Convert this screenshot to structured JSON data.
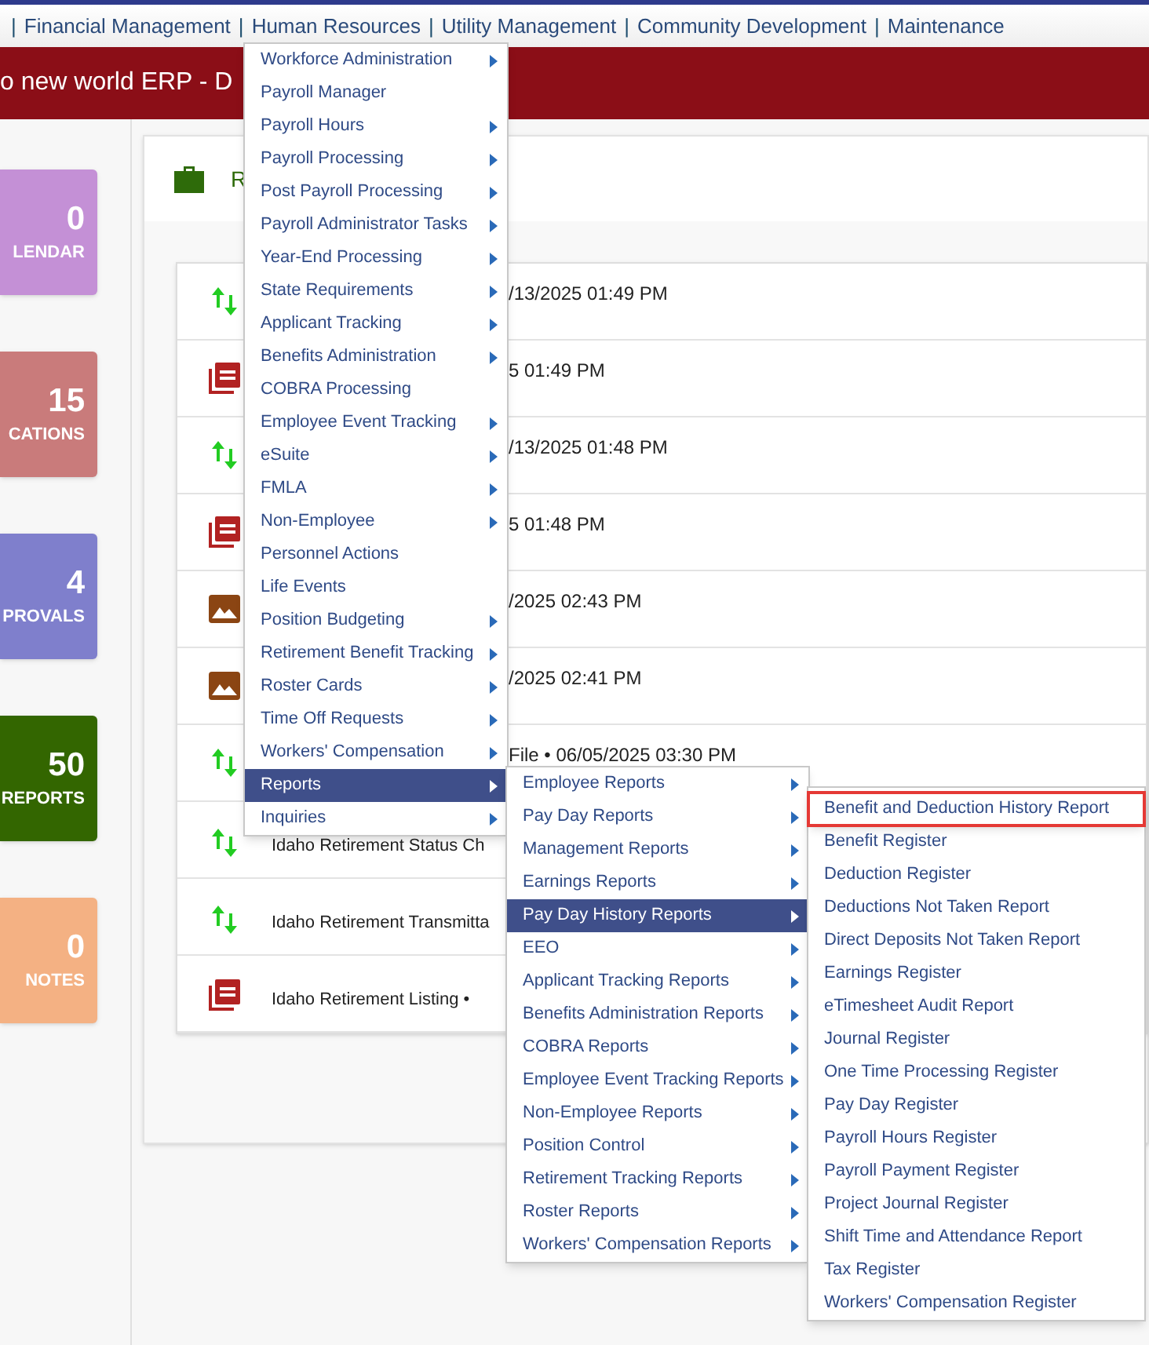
{
  "nav": {
    "items": [
      {
        "kind": "separator",
        "text": "|"
      },
      {
        "kind": "link",
        "text": "Financial Management"
      },
      {
        "kind": "separator",
        "text": "|"
      },
      {
        "kind": "link",
        "text": "Human Resources"
      },
      {
        "kind": "separator",
        "text": "|"
      },
      {
        "kind": "link",
        "text": "Utility Management"
      },
      {
        "kind": "separator",
        "text": "|"
      },
      {
        "kind": "link",
        "text": "Community Development"
      },
      {
        "kind": "separator",
        "text": "|"
      },
      {
        "kind": "link",
        "text": "Maintenance"
      }
    ]
  },
  "banner": {
    "title": "o new world ERP - D"
  },
  "tiles": [
    {
      "count": "0",
      "label": "LENDAR",
      "color": "#c490d6"
    },
    {
      "count": "15",
      "label": "CATIONS",
      "color": "#c97b7b"
    },
    {
      "count": "4",
      "label": "PROVALS",
      "color": "#7f7fcc"
    },
    {
      "count": "50",
      "label": "REPORTS",
      "color": "#336600"
    },
    {
      "count": "0",
      "label": "NOTES",
      "color": "#f4b183"
    }
  ],
  "panel": {
    "title": "R"
  },
  "rows": [
    {
      "kind": "transfer",
      "text": "/13/2025 01:49 PM",
      "start_hidden": true
    },
    {
      "kind": "pdf",
      "text": "5 01:49 PM",
      "start_hidden": true
    },
    {
      "kind": "transfer",
      "text": "/13/2025 01:48 PM",
      "start_hidden": true
    },
    {
      "kind": "pdf",
      "text": "5 01:48 PM",
      "start_hidden": true
    },
    {
      "kind": "image",
      "text": "/2025 02:43 PM",
      "start_hidden": true
    },
    {
      "kind": "image",
      "text": "/2025 02:41 PM",
      "start_hidden": true
    },
    {
      "kind": "transfer",
      "text": "File • 06/05/2025 03:30 PM",
      "start_hidden": true
    },
    {
      "kind": "transfer",
      "text": "Idaho Retirement Status Ch",
      "start_hidden": false
    },
    {
      "kind": "transfer",
      "text": "Idaho Retirement Transmitta",
      "start_hidden": false
    },
    {
      "kind": "pdf",
      "text": "Idaho Retirement Listing •",
      "start_hidden": false
    }
  ],
  "menus": [
    {
      "items": [
        {
          "label": "Workforce Administration",
          "submenu": true,
          "selected": false
        },
        {
          "label": "Payroll Manager",
          "submenu": false,
          "selected": false
        },
        {
          "label": "Payroll Hours",
          "submenu": true,
          "selected": false
        },
        {
          "label": "Payroll Processing",
          "submenu": true,
          "selected": false
        },
        {
          "label": "Post Payroll Processing",
          "submenu": true,
          "selected": false
        },
        {
          "label": "Payroll Administrator Tasks",
          "submenu": true,
          "selected": false
        },
        {
          "label": "Year-End Processing",
          "submenu": true,
          "selected": false
        },
        {
          "label": "State Requirements",
          "submenu": true,
          "selected": false
        },
        {
          "label": "Applicant Tracking",
          "submenu": true,
          "selected": false
        },
        {
          "label": "Benefits Administration",
          "submenu": true,
          "selected": false
        },
        {
          "label": "COBRA Processing",
          "submenu": false,
          "selected": false
        },
        {
          "label": "Employee Event Tracking",
          "submenu": true,
          "selected": false
        },
        {
          "label": "eSuite",
          "submenu": true,
          "selected": false
        },
        {
          "label": "FMLA",
          "submenu": true,
          "selected": false
        },
        {
          "label": "Non-Employee",
          "submenu": true,
          "selected": false
        },
        {
          "label": "Personnel Actions",
          "submenu": false,
          "selected": false
        },
        {
          "label": "Life Events",
          "submenu": false,
          "selected": false
        },
        {
          "label": "Position Budgeting",
          "submenu": true,
          "selected": false
        },
        {
          "label": "Retirement Benefit Tracking",
          "submenu": true,
          "selected": false
        },
        {
          "label": "Roster Cards",
          "submenu": true,
          "selected": false
        },
        {
          "label": "Time Off Requests",
          "submenu": true,
          "selected": false
        },
        {
          "label": "Workers' Compensation",
          "submenu": true,
          "selected": false
        },
        {
          "label": "Reports",
          "submenu": true,
          "selected": true
        },
        {
          "label": "Inquiries",
          "submenu": true,
          "selected": false
        }
      ]
    },
    {
      "items": [
        {
          "label": "Employee Reports",
          "submenu": true,
          "selected": false
        },
        {
          "label": "Pay Day Reports",
          "submenu": true,
          "selected": false
        },
        {
          "label": "Management Reports",
          "submenu": true,
          "selected": false
        },
        {
          "label": "Earnings Reports",
          "submenu": true,
          "selected": false
        },
        {
          "label": "Pay Day History Reports",
          "submenu": true,
          "selected": true
        },
        {
          "label": "EEO",
          "submenu": true,
          "selected": false
        },
        {
          "label": "Applicant Tracking Reports",
          "submenu": true,
          "selected": false
        },
        {
          "label": "Benefits Administration Reports",
          "submenu": true,
          "selected": false
        },
        {
          "label": "COBRA Reports",
          "submenu": true,
          "selected": false
        },
        {
          "label": "Employee Event Tracking Reports",
          "submenu": true,
          "selected": false
        },
        {
          "label": "Non-Employee Reports",
          "submenu": true,
          "selected": false
        },
        {
          "label": "Position Control",
          "submenu": true,
          "selected": false
        },
        {
          "label": "Retirement Tracking Reports",
          "submenu": true,
          "selected": false
        },
        {
          "label": "Roster Reports",
          "submenu": true,
          "selected": false
        },
        {
          "label": "Workers' Compensation Reports",
          "submenu": true,
          "selected": false
        }
      ]
    },
    {
      "items": [
        {
          "label": "Benefit and Deduction History Report",
          "focused": true
        },
        {
          "label": "Benefit Register",
          "focused": false
        },
        {
          "label": "Deduction Register",
          "focused": false
        },
        {
          "label": "Deductions Not Taken Report",
          "focused": false
        },
        {
          "label": "Direct Deposits Not Taken Report",
          "focused": false
        },
        {
          "label": "Earnings Register",
          "focused": false
        },
        {
          "label": "eTimesheet Audit Report",
          "focused": false
        },
        {
          "label": "Journal Register",
          "focused": false
        },
        {
          "label": "One Time Processing Register",
          "focused": false
        },
        {
          "label": "Pay Day Register",
          "focused": false
        },
        {
          "label": "Payroll Hours Register",
          "focused": false
        },
        {
          "label": "Payroll Payment Register",
          "focused": false
        },
        {
          "label": "Project Journal Register",
          "focused": false
        },
        {
          "label": "Shift Time and Attendance Report",
          "focused": false
        },
        {
          "label": "Tax Register",
          "focused": false
        },
        {
          "label": "Workers' Compensation Register",
          "focused": false
        }
      ]
    }
  ]
}
